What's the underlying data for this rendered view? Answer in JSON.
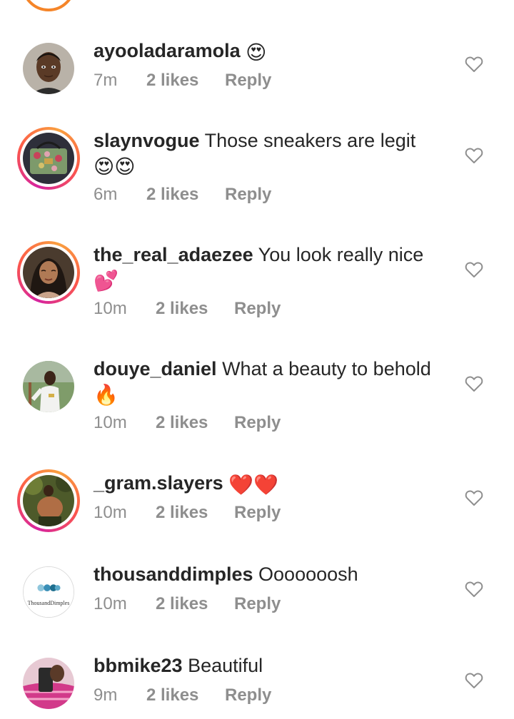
{
  "comments": [
    {
      "username": "ayooladaramola",
      "text": "",
      "emoji": "😍",
      "time": "7m",
      "likes": "2 likes",
      "reply": "Reply",
      "story_ring": false,
      "avatar": "portrait-man-dark"
    },
    {
      "username": "slaynvogue",
      "text": "Those sneakers are legit",
      "emoji": "😍😍",
      "time": "6m",
      "likes": "2 likes",
      "reply": "Reply",
      "story_ring": true,
      "avatar": "handbag-floral"
    },
    {
      "username": "the_real_adaezee",
      "text": "You look really nice",
      "emoji": "💕",
      "time": "10m",
      "likes": "2 likes",
      "reply": "Reply",
      "story_ring": true,
      "avatar": "portrait-woman"
    },
    {
      "username": "douye_daniel",
      "text": "What a beauty to behold",
      "emoji": "🔥",
      "time": "10m",
      "likes": "2 likes",
      "reply": "Reply",
      "story_ring": false,
      "avatar": "man-white-outfit-outdoor"
    },
    {
      "username": "_gram.slayers",
      "text": "",
      "emoji": "❤️❤️",
      "time": "10m",
      "likes": "2 likes",
      "reply": "Reply",
      "story_ring": true,
      "avatar": "person-outdoor-greenery"
    },
    {
      "username": "thousanddimples",
      "text": "Ooooooosh",
      "emoji": "",
      "time": "10m",
      "likes": "2 likes",
      "reply": "Reply",
      "story_ring": false,
      "avatar": "thousanddimples-logo",
      "avatar_label": "ThousandDimples"
    },
    {
      "username": "bbmike23",
      "text": "Beautiful",
      "emoji": "",
      "time": "9m",
      "likes": "2 likes",
      "reply": "Reply",
      "story_ring": false,
      "avatar": "person-phone-selfie-pink"
    }
  ],
  "colors": {
    "username": "#262626",
    "meta": "#8e8e8e",
    "heart_outline": "#8e8e8e",
    "story_ring_start": "#d6249f",
    "story_ring_end": "#f9a03f"
  }
}
